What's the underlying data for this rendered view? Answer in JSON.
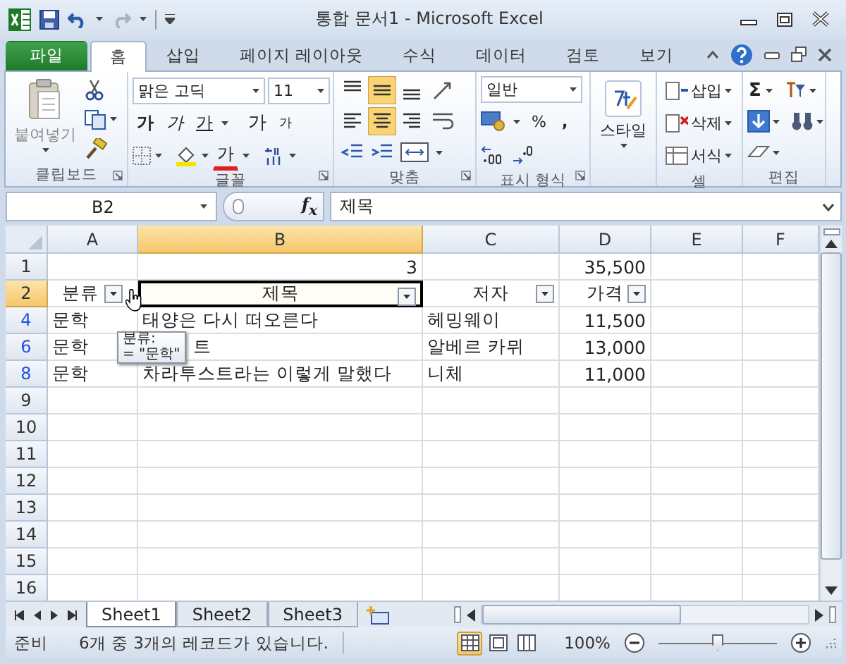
{
  "window": {
    "title": "통합 문서1 - Microsoft Excel"
  },
  "ribbon": {
    "tabs": [
      {
        "label": "파일",
        "kind": "file",
        "selected": false
      },
      {
        "label": "홈",
        "kind": "tab",
        "selected": true
      },
      {
        "label": "삽입",
        "kind": "tab",
        "selected": false
      },
      {
        "label": "페이지 레이아웃",
        "kind": "tab",
        "selected": false
      },
      {
        "label": "수식",
        "kind": "tab",
        "selected": false
      },
      {
        "label": "데이터",
        "kind": "tab",
        "selected": false
      },
      {
        "label": "검토",
        "kind": "tab",
        "selected": false
      },
      {
        "label": "보기",
        "kind": "tab",
        "selected": false
      }
    ],
    "clipboard": {
      "label": "클립보드",
      "paste": "붙여넣기"
    },
    "font": {
      "label": "글꼴",
      "font_name": "맑은 고딕",
      "font_size": "11",
      "bold": "가",
      "italic": "가",
      "underline": "가",
      "grow": "가",
      "shrink": "가",
      "font_color": "가"
    },
    "alignment": {
      "label": "맞춤",
      "vertical": [
        {
          "selected": false
        },
        {
          "selected": true
        },
        {
          "selected": false
        }
      ],
      "horizontal": [
        {
          "selected": false
        },
        {
          "selected": true
        },
        {
          "selected": false
        }
      ]
    },
    "number": {
      "label": "표시 형식",
      "format": "일반",
      "percent": "%",
      "comma": ","
    },
    "styles": {
      "label": "스타일"
    },
    "cells": {
      "label": "셀",
      "buttons": [
        "삽입",
        "삭제",
        "서식"
      ]
    },
    "editing": {
      "label": "편집",
      "sum": "Σ"
    }
  },
  "formula_bar": {
    "name_box": "B2",
    "function_label": "f$_{x}$",
    "formula": "제목"
  },
  "sheet": {
    "columns": [
      {
        "label": "A",
        "selected": false
      },
      {
        "label": "B",
        "selected": true
      },
      {
        "label": "C",
        "selected": false
      },
      {
        "label": "D",
        "selected": false
      },
      {
        "label": "E",
        "selected": false
      },
      {
        "label": "F",
        "selected": false
      }
    ],
    "rows": [
      {
        "number": "1",
        "selected": false,
        "filtered": false,
        "cells": [
          null,
          {
            "text": "3",
            "kind": "number",
            "selected": false
          },
          null,
          {
            "text": "35,500",
            "kind": "number",
            "selected": false
          },
          null,
          null
        ]
      },
      {
        "number": "2",
        "selected": true,
        "filtered": false,
        "cells": [
          {
            "text": "분류",
            "kind": "header",
            "selected": false
          },
          {
            "text": "제목",
            "kind": "header",
            "selected": true
          },
          {
            "text": "저자",
            "kind": "header",
            "selected": false
          },
          {
            "text": "가격",
            "kind": "header",
            "selected": false
          },
          null,
          null
        ]
      },
      {
        "number": "4",
        "selected": false,
        "filtered": true,
        "cells": [
          {
            "text": "문학",
            "kind": "text",
            "selected": false
          },
          {
            "text": "태양은 다시 떠오른다",
            "kind": "text",
            "selected": false
          },
          {
            "text": "헤밍웨이",
            "kind": "text",
            "selected": false
          },
          {
            "text": "11,500",
            "kind": "number",
            "selected": false
          },
          null,
          null
        ]
      },
      {
        "number": "6",
        "selected": false,
        "filtered": true,
        "cells": [
          {
            "text": "문학",
            "kind": "text",
            "selected": false
          },
          {
            "text": "트",
            "kind": "covered",
            "selected": false
          },
          {
            "text": "알베르 카뮈",
            "kind": "text",
            "selected": false
          },
          {
            "text": "13,000",
            "kind": "number",
            "selected": false
          },
          null,
          null
        ]
      },
      {
        "number": "8",
        "selected": false,
        "filtered": true,
        "cells": [
          {
            "text": "문학",
            "kind": "text",
            "selected": false
          },
          {
            "text": "차라투스트라는 이렇게 말했다",
            "kind": "text",
            "selected": false
          },
          {
            "text": "니체",
            "kind": "text",
            "selected": false
          },
          {
            "text": "11,000",
            "kind": "number",
            "selected": false
          },
          null,
          null
        ]
      },
      {
        "number": "9",
        "selected": false,
        "filtered": false,
        "cells": [
          null,
          null,
          null,
          null,
          null,
          null
        ]
      },
      {
        "number": "10",
        "selected": false,
        "filtered": false,
        "cells": [
          null,
          null,
          null,
          null,
          null,
          null
        ]
      },
      {
        "number": "11",
        "selected": false,
        "filtered": false,
        "cells": [
          null,
          null,
          null,
          null,
          null,
          null
        ]
      },
      {
        "number": "12",
        "selected": false,
        "filtered": false,
        "cells": [
          null,
          null,
          null,
          null,
          null,
          null
        ]
      },
      {
        "number": "13",
        "selected": false,
        "filtered": false,
        "cells": [
          null,
          null,
          null,
          null,
          null,
          null
        ]
      },
      {
        "number": "14",
        "selected": false,
        "filtered": false,
        "cells": [
          null,
          null,
          null,
          null,
          null,
          null
        ]
      },
      {
        "number": "15",
        "selected": false,
        "filtered": false,
        "cells": [
          null,
          null,
          null,
          null,
          null,
          null
        ]
      },
      {
        "number": "16",
        "selected": false,
        "filtered": false,
        "cells": [
          null,
          null,
          null,
          null,
          null,
          null
        ]
      }
    ],
    "tooltip": {
      "title": "분류:",
      "text": "= \"문학\""
    }
  },
  "sheet_tabs": [
    {
      "label": "Sheet1",
      "selected": true
    },
    {
      "label": "Sheet2",
      "selected": false
    },
    {
      "label": "Sheet3",
      "selected": false
    }
  ],
  "status_bar": {
    "mode": "준비",
    "message": "6개 중 3개의 레코드가 있습니다.",
    "views": [
      {
        "selected": true
      },
      {
        "selected": false
      },
      {
        "selected": false
      }
    ],
    "zoom_percent": "100%",
    "zoom": {
      "level": 0.5
    }
  }
}
